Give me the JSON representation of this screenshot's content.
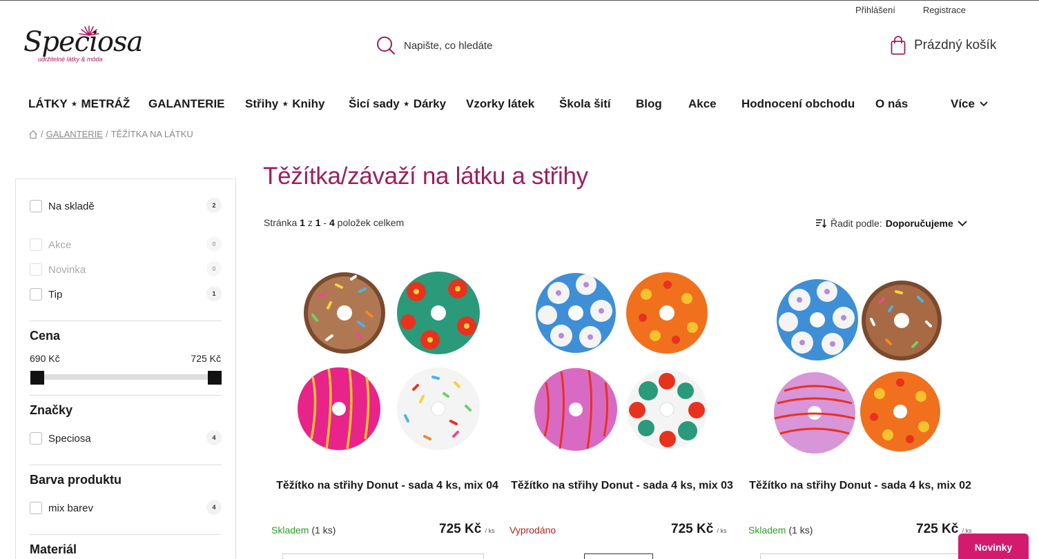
{
  "header": {
    "login": "Přihlášení",
    "register": "Registrace",
    "logo_text": "Speciosa",
    "logo_tagline": "udržitelné látky & móda",
    "search_placeholder": "Napište, co hledáte",
    "cart_label": "Prázdný košík"
  },
  "nav": {
    "items": [
      "LÁTKY ⋆ METRÁŽ",
      "GALANTERIE",
      "Střihy ⋆ Knihy",
      "Šicí sady ⋆ Dárky",
      "Vzorky látek",
      "Škola šití",
      "Blog",
      "Akce",
      "Hodnocení obchodu",
      "O nás",
      "Více"
    ]
  },
  "breadcrumb": {
    "separator": "/",
    "category": "GALANTERIE",
    "current": "TĚŽÍTKA NA LÁTKU"
  },
  "filters": {
    "in_stock": {
      "label": "Na skladě",
      "count": "2"
    },
    "sale": {
      "label": "Akce",
      "count": "0"
    },
    "new": {
      "label": "Novinka",
      "count": "0"
    },
    "tip": {
      "label": "Tip",
      "count": "1"
    },
    "price": {
      "title": "Cena",
      "min": "690 Kč",
      "max": "725 Kč"
    },
    "brands": {
      "title": "Značky",
      "item": "Speciosa",
      "count": "4"
    },
    "color": {
      "title": "Barva produktu",
      "item": "mix barev",
      "count": "4"
    },
    "material": {
      "title": "Materiál"
    }
  },
  "main": {
    "title": "Těžítka/závaží na látku a střihy",
    "page_word": "Stránka",
    "page": "1",
    "of_word": "z",
    "range_from": "1",
    "range_to": "4",
    "total_suffix": "položek celkem",
    "sort_label": "Řadit podle:",
    "sort_value": "Doporučujeme"
  },
  "products": [
    {
      "name": "Těžítko na střihy Donut - sada 4 ks, mix 04",
      "stock": "Skladem",
      "stock_color": "#2a9d2a",
      "qty": "(1 ks)",
      "price": "725 Kč",
      "unit": "/ ks"
    },
    {
      "name": "Těžítko na střihy Donut - sada 4 ks, mix 03",
      "stock": "Vyprodáno",
      "stock_color": "#b22222",
      "qty": "",
      "price": "725 Kč",
      "unit": "/ ks"
    },
    {
      "name": "Těžítko na střihy Donut - sada 4 ks, mix 02",
      "stock": "Skladem",
      "stock_color": "#2a9d2a",
      "qty": "(1 ks)",
      "price": "725 Kč",
      "unit": "/ ks"
    }
  ],
  "novinky": "Novinky",
  "colors": {
    "brand": "#9b1f5f",
    "accent": "#d41a6f"
  }
}
